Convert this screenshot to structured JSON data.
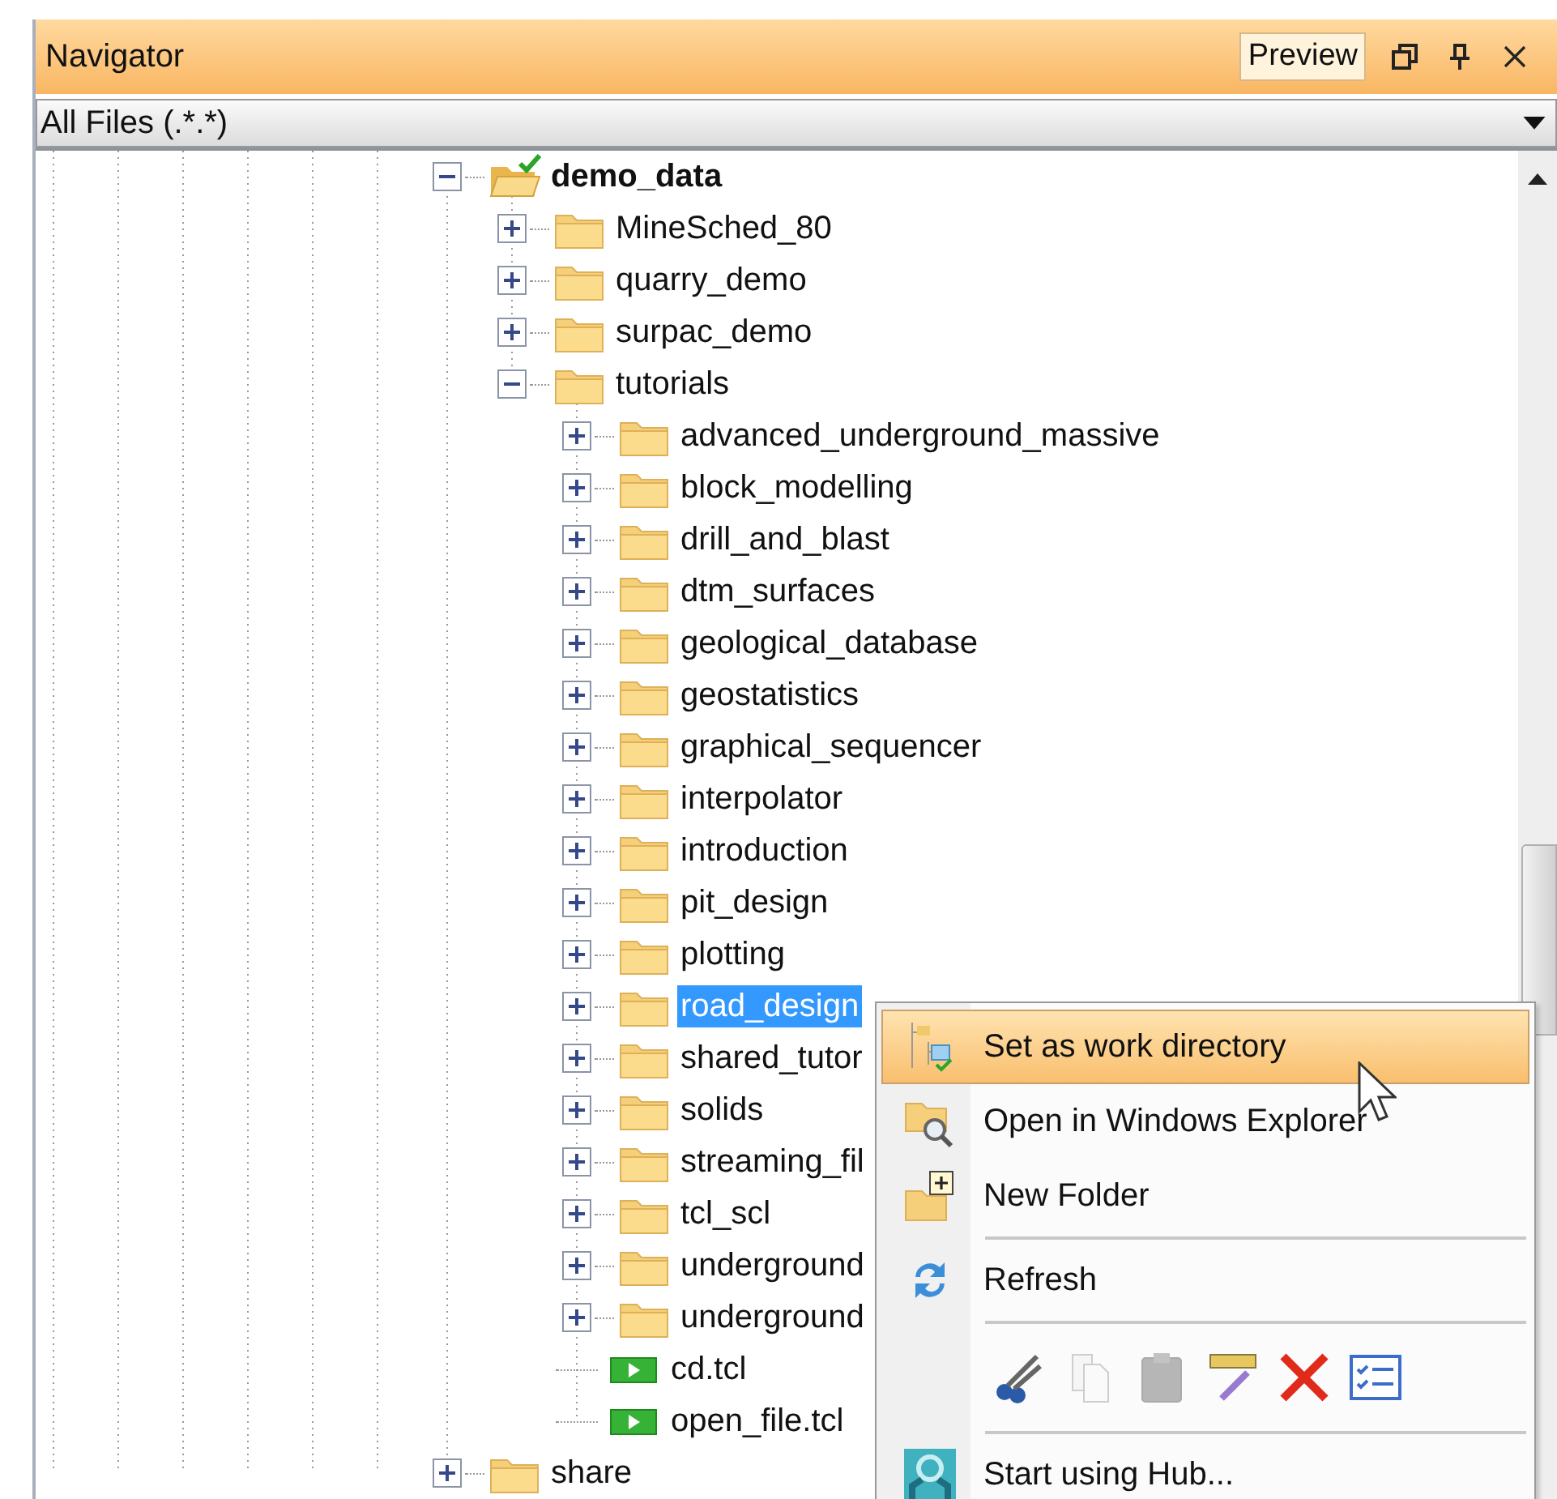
{
  "panel": {
    "title": "Navigator",
    "preview_button": {
      "label": "Preview",
      "on": true
    }
  },
  "filter": {
    "value": "All Files (.*.*)"
  },
  "tree": [
    {
      "kind": "folder",
      "label": "demo_data",
      "expanded": true,
      "selected": false,
      "current": true,
      "children": [
        {
          "kind": "folder",
          "label": "MineSched_80",
          "expanded": false,
          "selected": false,
          "current": false
        },
        {
          "kind": "folder",
          "label": "quarry_demo",
          "expanded": false,
          "selected": false,
          "current": false
        },
        {
          "kind": "folder",
          "label": "surpac_demo",
          "expanded": false,
          "selected": false,
          "current": false
        },
        {
          "kind": "folder",
          "label": "tutorials",
          "expanded": true,
          "selected": false,
          "current": false,
          "children": [
            {
              "kind": "folder",
              "label": "advanced_underground_massive",
              "expanded": false,
              "selected": false,
              "current": false
            },
            {
              "kind": "folder",
              "label": "block_modelling",
              "expanded": false,
              "selected": false,
              "current": false
            },
            {
              "kind": "folder",
              "label": "drill_and_blast",
              "expanded": false,
              "selected": false,
              "current": false
            },
            {
              "kind": "folder",
              "label": "dtm_surfaces",
              "expanded": false,
              "selected": false,
              "current": false
            },
            {
              "kind": "folder",
              "label": "geological_database",
              "expanded": false,
              "selected": false,
              "current": false
            },
            {
              "kind": "folder",
              "label": "geostatistics",
              "expanded": false,
              "selected": false,
              "current": false
            },
            {
              "kind": "folder",
              "label": "graphical_sequencer",
              "expanded": false,
              "selected": false,
              "current": false
            },
            {
              "kind": "folder",
              "label": "interpolator",
              "expanded": false,
              "selected": false,
              "current": false
            },
            {
              "kind": "folder",
              "label": "introduction",
              "expanded": false,
              "selected": false,
              "current": false
            },
            {
              "kind": "folder",
              "label": "pit_design",
              "expanded": false,
              "selected": false,
              "current": false
            },
            {
              "kind": "folder",
              "label": "plotting",
              "expanded": false,
              "selected": false,
              "current": false
            },
            {
              "kind": "folder",
              "label": "road_design",
              "expanded": false,
              "selected": true,
              "current": false
            },
            {
              "kind": "folder",
              "label": "shared_tutor",
              "expanded": false,
              "selected": false,
              "current": false
            },
            {
              "kind": "folder",
              "label": "solids",
              "expanded": false,
              "selected": false,
              "current": false
            },
            {
              "kind": "folder",
              "label": "streaming_fil",
              "expanded": false,
              "selected": false,
              "current": false
            },
            {
              "kind": "folder",
              "label": "tcl_scl",
              "expanded": false,
              "selected": false,
              "current": false
            },
            {
              "kind": "folder",
              "label": "underground",
              "expanded": false,
              "selected": false,
              "current": false
            },
            {
              "kind": "folder",
              "label": "underground",
              "expanded": false,
              "selected": false,
              "current": false
            },
            {
              "kind": "file",
              "label": "cd.tcl",
              "selected": false,
              "current": false
            },
            {
              "kind": "file",
              "label": "open_file.tcl",
              "selected": false,
              "current": false
            }
          ]
        }
      ]
    },
    {
      "kind": "folder",
      "label": "share",
      "expanded": false,
      "selected": false,
      "current": false
    }
  ],
  "context_menu": [
    {
      "kind": "workdir",
      "label": "Set as work directory",
      "selected": true
    },
    {
      "kind": "explore",
      "label": "Open in Windows Explorer",
      "selected": false
    },
    {
      "kind": "new-folder",
      "label": "New Folder",
      "selected": false
    },
    {
      "kind": "separator"
    },
    {
      "kind": "refresh",
      "label": "Refresh",
      "selected": false
    },
    {
      "kind": "separator"
    },
    {
      "kind": "tools",
      "tools": [
        {
          "kind": "cut",
          "disabled": false
        },
        {
          "kind": "copy",
          "disabled": true
        },
        {
          "kind": "paste",
          "disabled": true
        },
        {
          "kind": "rename",
          "disabled": false
        },
        {
          "kind": "delete",
          "disabled": false
        },
        {
          "kind": "properties",
          "disabled": false
        }
      ]
    },
    {
      "kind": "separator"
    },
    {
      "kind": "hub",
      "label": "Start using Hub...",
      "selected": false
    }
  ]
}
